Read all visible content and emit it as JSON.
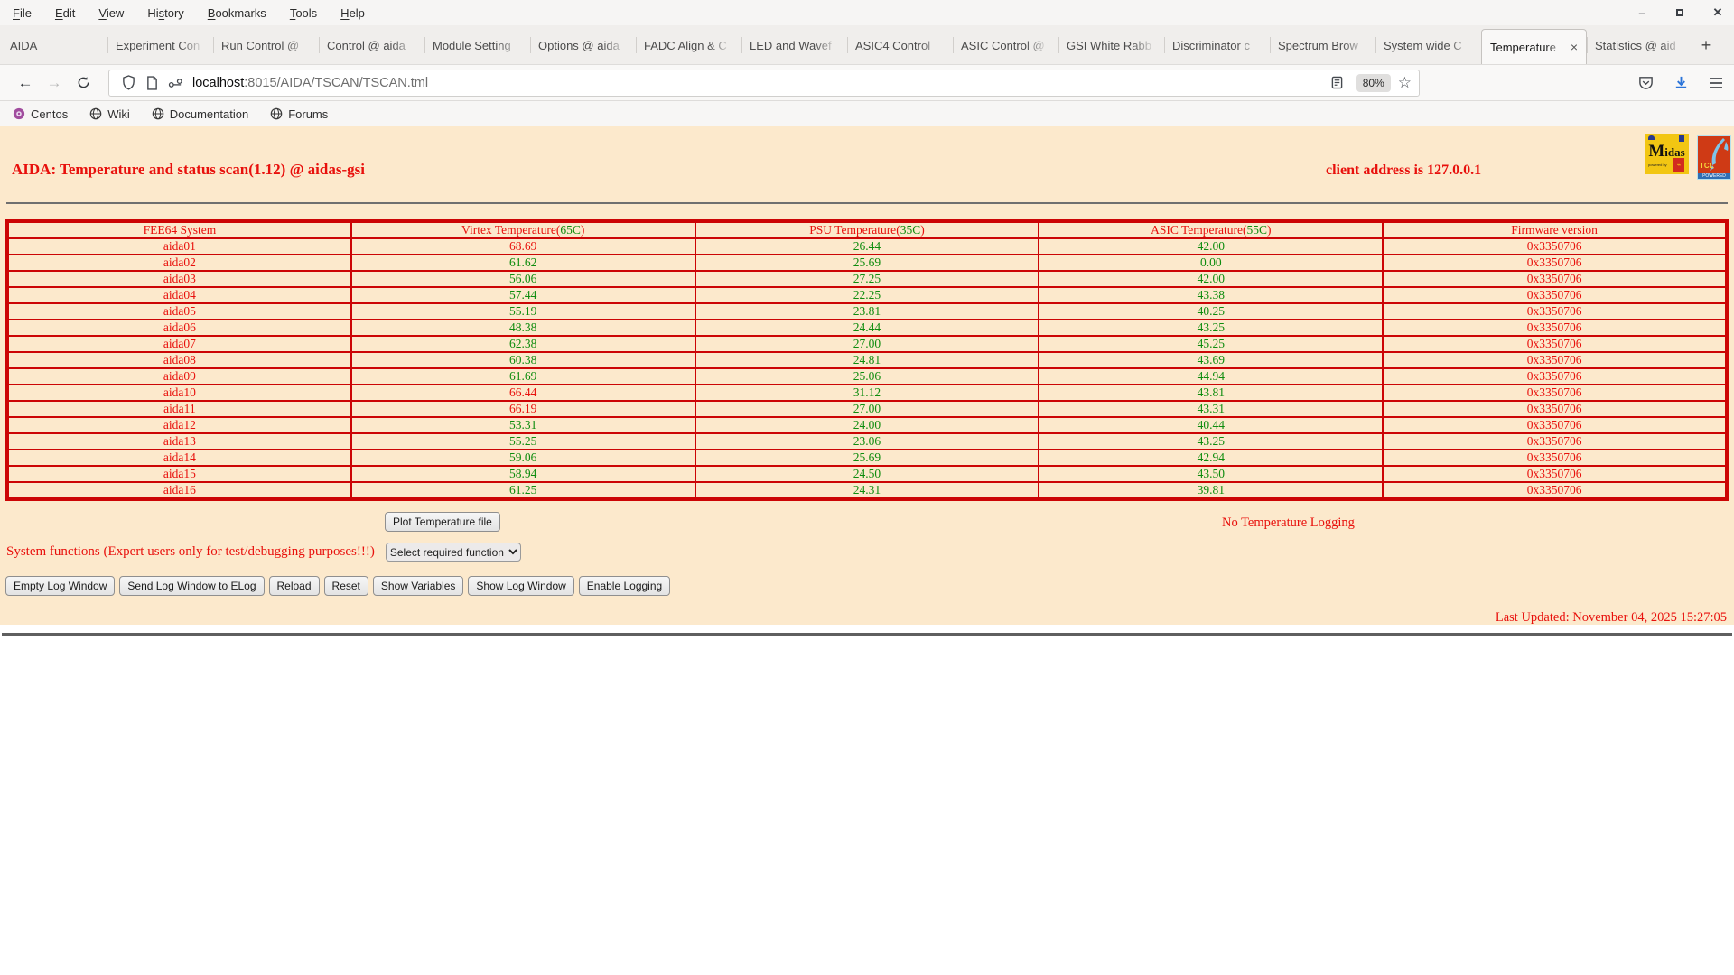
{
  "window": {
    "menus": [
      {
        "pre": "",
        "key": "F",
        "post": "ile"
      },
      {
        "pre": "",
        "key": "E",
        "post": "dit"
      },
      {
        "pre": "",
        "key": "V",
        "post": "iew"
      },
      {
        "pre": "Hi",
        "key": "s",
        "post": "tory"
      },
      {
        "pre": "",
        "key": "B",
        "post": "ookmarks"
      },
      {
        "pre": "",
        "key": "T",
        "post": "ools"
      },
      {
        "pre": "",
        "key": "H",
        "post": "elp"
      }
    ],
    "controls": {
      "minimize": "–",
      "maximize": "□",
      "close": "✕"
    }
  },
  "tabs": {
    "items": [
      {
        "label": "AIDA",
        "active": false
      },
      {
        "label": "Experiment Con",
        "active": false
      },
      {
        "label": "Run Control @",
        "active": false
      },
      {
        "label": "Control @ aida",
        "active": false
      },
      {
        "label": "Module Setting",
        "active": false
      },
      {
        "label": "Options @ aida",
        "active": false
      },
      {
        "label": "FADC Align & C",
        "active": false
      },
      {
        "label": "LED and Wavef",
        "active": false
      },
      {
        "label": "ASIC4 Control",
        "active": false
      },
      {
        "label": "ASIC Control @",
        "active": false
      },
      {
        "label": "GSI White Rabb",
        "active": false
      },
      {
        "label": "Discriminator c",
        "active": false
      },
      {
        "label": "Spectrum Brow",
        "active": false
      },
      {
        "label": "System wide C",
        "active": false
      },
      {
        "label": "Temperature",
        "active": true
      },
      {
        "label": "Statistics @ aid",
        "active": false
      }
    ],
    "close_label": "×",
    "new_tab_label": "+"
  },
  "nav": {
    "url_domain": "localhost",
    "url_rest": ":8015/AIDA/TSCAN/TSCAN.tml",
    "zoom_level": "80%",
    "star": "☆"
  },
  "bookmarks": [
    {
      "label": "Centos",
      "icon": "centos-icon"
    },
    {
      "label": "Wiki",
      "icon": "globe-icon"
    },
    {
      "label": "Documentation",
      "icon": "globe-icon"
    },
    {
      "label": "Forums",
      "icon": "globe-icon"
    }
  ],
  "page": {
    "title": "AIDA: Temperature and status scan(1.12) @ aidas-gsi",
    "client_address": "client address is 127.0.0.1",
    "table": {
      "headers": [
        {
          "label": "FEE64 System",
          "limit": ""
        },
        {
          "label": "Virtex Temperature",
          "limit": "65C"
        },
        {
          "label": "PSU Temperature",
          "limit": "35C"
        },
        {
          "label": "ASIC Temperature",
          "limit": "55C"
        },
        {
          "label": "Firmware version",
          "limit": ""
        }
      ],
      "rows": [
        {
          "system": "aida01",
          "virtex": "68.69",
          "virtex_alarm": true,
          "psu": "26.44",
          "psu_alarm": false,
          "asic": "42.00",
          "asic_alarm": false,
          "firmware": "0x3350706"
        },
        {
          "system": "aida02",
          "virtex": "61.62",
          "virtex_alarm": false,
          "psu": "25.69",
          "psu_alarm": false,
          "asic": "0.00",
          "asic_alarm": false,
          "firmware": "0x3350706"
        },
        {
          "system": "aida03",
          "virtex": "56.06",
          "virtex_alarm": false,
          "psu": "27.25",
          "psu_alarm": false,
          "asic": "42.00",
          "asic_alarm": false,
          "firmware": "0x3350706"
        },
        {
          "system": "aida04",
          "virtex": "57.44",
          "virtex_alarm": false,
          "psu": "22.25",
          "psu_alarm": false,
          "asic": "43.38",
          "asic_alarm": false,
          "firmware": "0x3350706"
        },
        {
          "system": "aida05",
          "virtex": "55.19",
          "virtex_alarm": false,
          "psu": "23.81",
          "psu_alarm": false,
          "asic": "40.25",
          "asic_alarm": false,
          "firmware": "0x3350706"
        },
        {
          "system": "aida06",
          "virtex": "48.38",
          "virtex_alarm": false,
          "psu": "24.44",
          "psu_alarm": false,
          "asic": "43.25",
          "asic_alarm": false,
          "firmware": "0x3350706"
        },
        {
          "system": "aida07",
          "virtex": "62.38",
          "virtex_alarm": false,
          "psu": "27.00",
          "psu_alarm": false,
          "asic": "45.25",
          "asic_alarm": false,
          "firmware": "0x3350706"
        },
        {
          "system": "aida08",
          "virtex": "60.38",
          "virtex_alarm": false,
          "psu": "24.81",
          "psu_alarm": false,
          "asic": "43.69",
          "asic_alarm": false,
          "firmware": "0x3350706"
        },
        {
          "system": "aida09",
          "virtex": "61.69",
          "virtex_alarm": false,
          "psu": "25.06",
          "psu_alarm": false,
          "asic": "44.94",
          "asic_alarm": false,
          "firmware": "0x3350706"
        },
        {
          "system": "aida10",
          "virtex": "66.44",
          "virtex_alarm": true,
          "psu": "31.12",
          "psu_alarm": false,
          "asic": "43.81",
          "asic_alarm": false,
          "firmware": "0x3350706"
        },
        {
          "system": "aida11",
          "virtex": "66.19",
          "virtex_alarm": true,
          "psu": "27.00",
          "psu_alarm": false,
          "asic": "43.31",
          "asic_alarm": false,
          "firmware": "0x3350706"
        },
        {
          "system": "aida12",
          "virtex": "53.31",
          "virtex_alarm": false,
          "psu": "24.00",
          "psu_alarm": false,
          "asic": "40.44",
          "asic_alarm": false,
          "firmware": "0x3350706"
        },
        {
          "system": "aida13",
          "virtex": "55.25",
          "virtex_alarm": false,
          "psu": "23.06",
          "psu_alarm": false,
          "asic": "43.25",
          "asic_alarm": false,
          "firmware": "0x3350706"
        },
        {
          "system": "aida14",
          "virtex": "59.06",
          "virtex_alarm": false,
          "psu": "25.69",
          "psu_alarm": false,
          "asic": "42.94",
          "asic_alarm": false,
          "firmware": "0x3350706"
        },
        {
          "system": "aida15",
          "virtex": "58.94",
          "virtex_alarm": false,
          "psu": "24.50",
          "psu_alarm": false,
          "asic": "43.50",
          "asic_alarm": false,
          "firmware": "0x3350706"
        },
        {
          "system": "aida16",
          "virtex": "61.25",
          "virtex_alarm": false,
          "psu": "24.31",
          "psu_alarm": false,
          "asic": "39.81",
          "asic_alarm": false,
          "firmware": "0x3350706"
        }
      ]
    },
    "plot_button_label": "Plot Temperature file",
    "logging_status": "No Temperature Logging",
    "system_functions_label": "System functions (Expert users only for test/debugging purposes!!!)",
    "select_value": "Select required function",
    "action_buttons": [
      "Empty Log Window",
      "Send Log Window to ELog",
      "Reload",
      "Reset",
      "Show Variables",
      "Show Log Window",
      "Enable Logging"
    ],
    "last_updated": "Last Updated: November 04, 2025 15:27:05",
    "colors": {
      "page_bg": "#fce9cc",
      "text_red": "#e8100c",
      "value_green": "#0e8c0e",
      "table_border": "#cc0505"
    }
  },
  "logos": {
    "midas": {
      "big": "M",
      "rest": "idas",
      "sub": "powered by"
    },
    "tcl": {
      "line1": "TCL",
      "line2": "POWERED"
    }
  }
}
